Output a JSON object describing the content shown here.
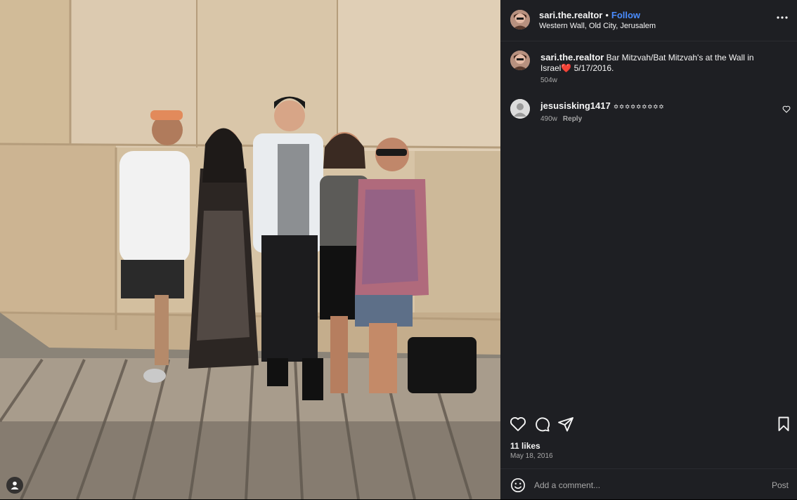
{
  "post": {
    "username": "sari.the.realtor",
    "follow_label": "Follow",
    "location": "Western Wall, Old City, Jerusalem",
    "caption": {
      "username": "sari.the.realtor",
      "text": "Bar Mitzvah/Bat Mitzvah's at the Wall in Israel",
      "emoji": "❤️",
      "text_after": " 5/17/2016.",
      "time": "504w"
    },
    "comments": [
      {
        "username": "jesusisking1417",
        "text": "✡︎✡︎✡︎✡︎✡︎✡︎✡︎✡︎✡︎",
        "time": "490w",
        "reply_label": "Reply"
      }
    ],
    "likes": "11 likes",
    "date": "May 18, 2016",
    "comment_placeholder": "Add a comment...",
    "post_label": "Post"
  },
  "colors": {
    "panel_bg": "#1e1f23",
    "link_blue": "#4a8dff",
    "muted": "#a8a8a8"
  },
  "icons": [
    "more-icon",
    "heart-icon",
    "comment-icon",
    "share-icon",
    "bookmark-icon",
    "emoji-icon",
    "user-tag-icon"
  ]
}
